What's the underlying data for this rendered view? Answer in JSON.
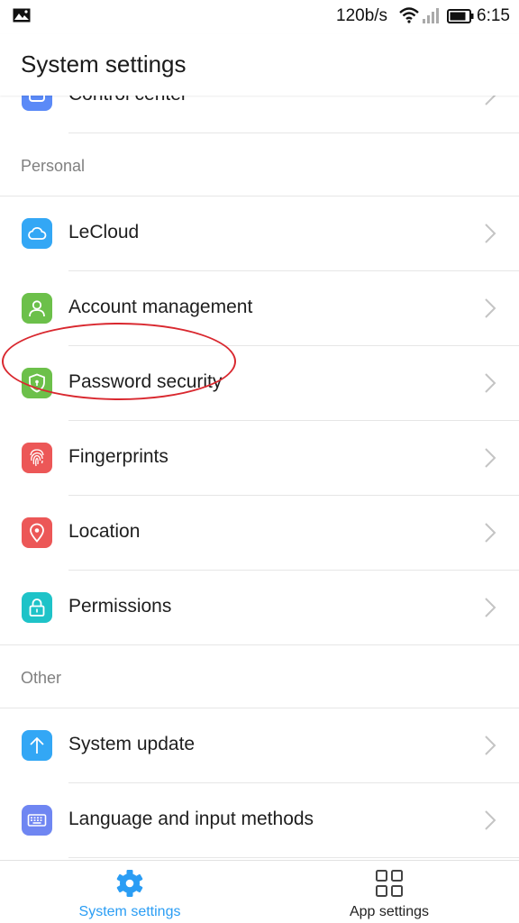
{
  "status_bar": {
    "speed": "120b/s",
    "time": "6:15"
  },
  "header": {
    "title": "System settings"
  },
  "partial_item": {
    "label": "Control center",
    "icon": "control-center-icon",
    "color": "#5b8af7"
  },
  "sections": [
    {
      "header": "Personal",
      "items": [
        {
          "label": "LeCloud",
          "icon": "cloud-icon",
          "color": "#33a7f5"
        },
        {
          "label": "Account management",
          "icon": "person-icon",
          "color": "#6cc04a"
        },
        {
          "label": "Password security",
          "icon": "shield-icon",
          "color": "#6cc04a"
        },
        {
          "label": "Fingerprints",
          "icon": "fingerprint-icon",
          "color": "#ec5757"
        },
        {
          "label": "Location",
          "icon": "location-pin-icon",
          "color": "#ec5757"
        },
        {
          "label": "Permissions",
          "icon": "lock-icon",
          "color": "#1ec3c8"
        }
      ]
    },
    {
      "header": "Other",
      "items": [
        {
          "label": "System update",
          "icon": "arrow-up-icon",
          "color": "#33a7f5"
        },
        {
          "label": "Language and input methods",
          "icon": "keyboard-icon",
          "color": "#6f86f2"
        }
      ]
    }
  ],
  "bottom_nav": {
    "tabs": [
      {
        "label": "System settings",
        "icon": "gear-icon",
        "active": true
      },
      {
        "label": "App settings",
        "icon": "grid-icon",
        "active": false
      }
    ],
    "active_color": "#2a9df4"
  }
}
